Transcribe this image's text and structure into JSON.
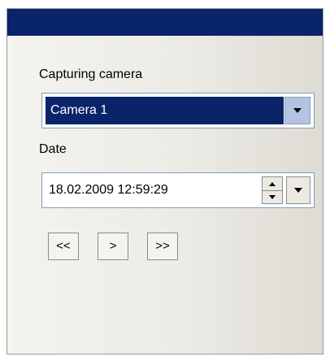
{
  "camera_label": "Capturing camera",
  "camera_select": {
    "selected": "Camera 1"
  },
  "date_label": "Date",
  "date_picker": {
    "value": "18.02.2009 12:59:29"
  },
  "nav": {
    "prev": "<<",
    "play": ">",
    "next": ">>"
  },
  "colors": {
    "titlebar": "#0a246a",
    "selection": "#0a246a",
    "dropdown_button": "#b4c3e2",
    "panel": "#ecebe6"
  },
  "icons": {
    "combo_dropdown": "chevron-down-icon",
    "spin_up": "spin-up-icon",
    "spin_down": "spin-down-icon",
    "date_dropdown": "chevron-down-icon"
  }
}
